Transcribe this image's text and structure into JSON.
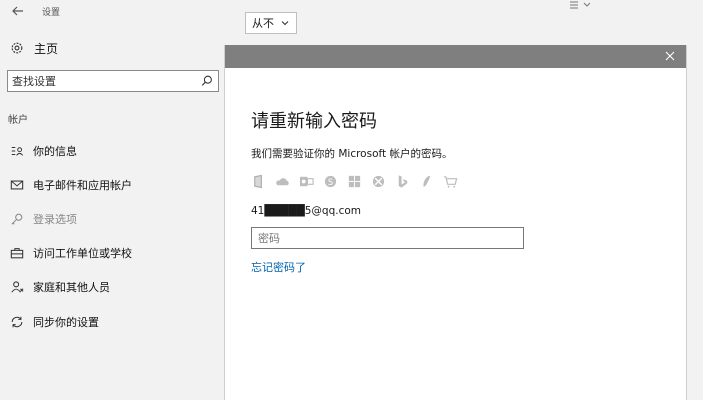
{
  "window": {
    "title": "设置"
  },
  "left_pane": {
    "home_label": "主页",
    "search": {
      "value": "查找设置"
    },
    "section_title": "帐户",
    "items": [
      {
        "label": "你的信息",
        "icon": "contact-card-icon",
        "dim": false
      },
      {
        "label": "电子邮件和应用帐户",
        "icon": "mail-icon",
        "dim": false
      },
      {
        "label": "登录选项",
        "icon": "key-icon",
        "dim": true
      },
      {
        "label": "访问工作单位或学校",
        "icon": "briefcase-icon",
        "dim": false
      },
      {
        "label": "家庭和其他人员",
        "icon": "person-icon",
        "dim": false
      },
      {
        "label": "同步你的设置",
        "icon": "sync-icon",
        "dim": false
      }
    ]
  },
  "background": {
    "select_value": "从不"
  },
  "dialog": {
    "heading": "请重新输入密码",
    "description": "我们需要验证你的 Microsoft 帐户的密码。",
    "services": [
      "office-icon",
      "onedrive-icon",
      "outlook-icon",
      "skype-icon",
      "windows-icon",
      "xbox-icon",
      "bing-icon",
      "msn-icon",
      "store-icon"
    ],
    "email": "41█████5@qq.com",
    "password_placeholder": "密码",
    "forgot_link": "忘记密码了"
  }
}
